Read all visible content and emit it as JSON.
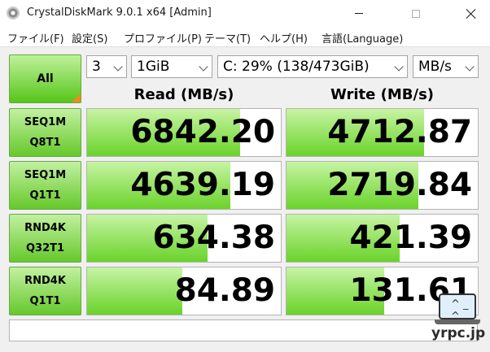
{
  "window": {
    "title": "CrystalDiskMark 9.0.1 x64 [Admin]"
  },
  "menu": [
    "ファイル(F)",
    "設定(S)",
    "プロファイル(P)",
    "テーマ(T)",
    "ヘルプ(H)",
    "言語(Language)"
  ],
  "controls": {
    "all_label": "All",
    "count": "3",
    "size": "1GiB",
    "drive": "C: 29% (138/473GiB)",
    "unit": "MB/s"
  },
  "headers": {
    "read": "Read (MB/s)",
    "write": "Write (MB/s)"
  },
  "tests": [
    {
      "line1": "SEQ1M",
      "line2": "Q8T1",
      "read": "6842.20",
      "write": "4712.87",
      "read_fill": 0.79,
      "write_fill": 0.72
    },
    {
      "line1": "SEQ1M",
      "line2": "Q1T1",
      "read": "4639.19",
      "write": "2719.84",
      "read_fill": 0.74,
      "write_fill": 0.69
    },
    {
      "line1": "RND4K",
      "line2": "Q32T1",
      "read": "634.38",
      "write": "421.39",
      "read_fill": 0.62,
      "write_fill": 0.59
    },
    {
      "line1": "RND4K",
      "line2": "Q1T1",
      "read": "84.89",
      "write": "131.61",
      "read_fill": 0.49,
      "write_fill": 0.51
    }
  ],
  "comment": "",
  "watermark": "yrpc.jp",
  "colors": {
    "bar": "#6ad32a",
    "button": "#66c82c",
    "all_corner": "#f08a1a"
  }
}
